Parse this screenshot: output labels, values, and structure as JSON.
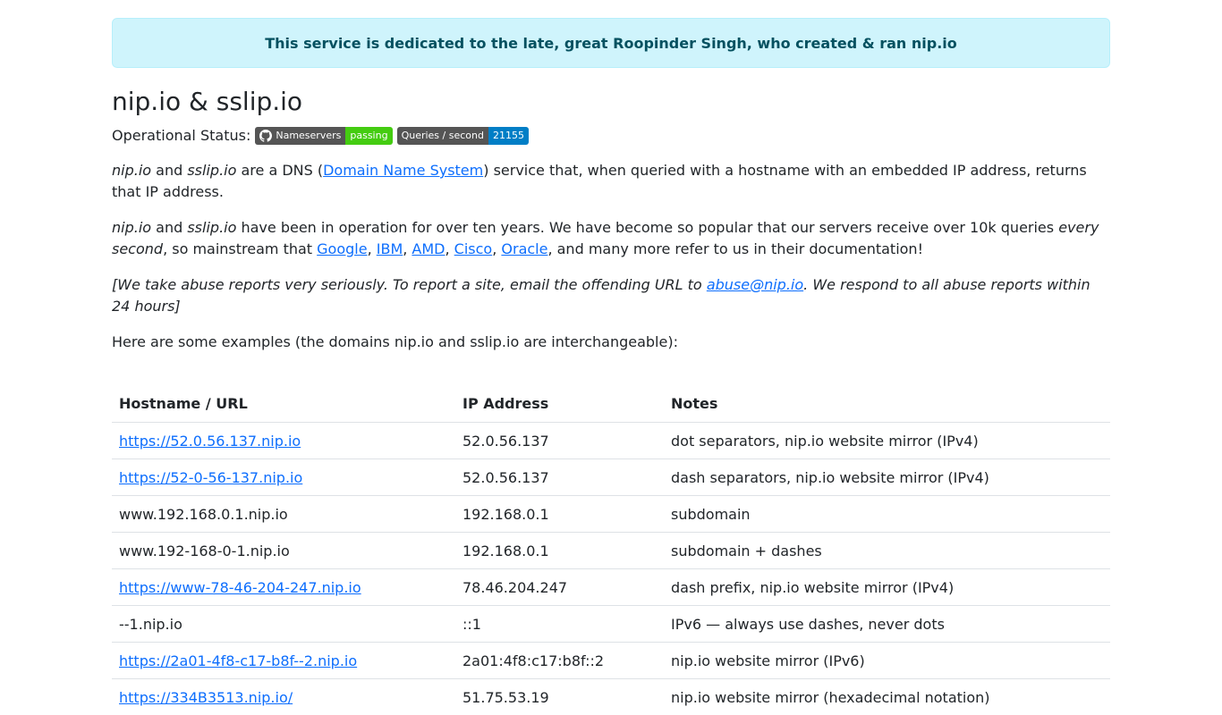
{
  "banner": "This service is dedicated to the late, great Roopinder Singh, who created & ran nip.io",
  "title": "nip.io & sslip.io",
  "status": {
    "label": "Operational Status:",
    "badge1": {
      "left": "Nameservers",
      "right": "passing",
      "right_color": "#4c1"
    },
    "badge2": {
      "left": "Queries / second",
      "right": "21155",
      "right_color": "#007ec6"
    }
  },
  "intro": {
    "nip": "nip.io",
    "and": " and ",
    "sslip": "sslip.io",
    "text1": " are a DNS (",
    "link": "Domain Name System",
    "text2": ") service that, when queried with a hostname with an embedded IP address, returns that IP address."
  },
  "popularity": {
    "nip": "nip.io",
    "and": " and ",
    "sslip": "sslip.io",
    "text1": " have been in operation for over ten years. We have become so popular that our servers receive over 10k queries ",
    "em": "every second",
    "text2": ", so mainstream that ",
    "links": [
      "Google",
      "IBM",
      "AMD",
      "Cisco",
      "Oracle"
    ],
    "sep": ", ",
    "text3": ", and many more refer to us in their documentation!"
  },
  "abuse": {
    "text1": "[We take abuse reports very seriously. To report a site, email the offending URL to ",
    "email": "abuse@nip.io",
    "text2": ". We respond to all abuse reports within 24 hours]"
  },
  "examples_intro": "Here are some examples (the domains nip.io and sslip.io are interchangeable):",
  "table": {
    "headers": [
      "Hostname / URL",
      "IP Address",
      "Notes"
    ],
    "rows": [
      {
        "host": "https://52.0.56.137.nip.io",
        "link": true,
        "ip": "52.0.56.137",
        "notes": "dot separators, nip.io website mirror (IPv4)"
      },
      {
        "host": "https://52-0-56-137.nip.io",
        "link": true,
        "ip": "52.0.56.137",
        "notes": "dash separators, nip.io website mirror (IPv4)"
      },
      {
        "host": "www.192.168.0.1.nip.io",
        "link": false,
        "ip": "192.168.0.1",
        "notes": "subdomain"
      },
      {
        "host": "www.192-168-0-1.nip.io",
        "link": false,
        "ip": "192.168.0.1",
        "notes": "subdomain + dashes"
      },
      {
        "host": "https://www-78-46-204-247.nip.io",
        "link": true,
        "ip": "78.46.204.247",
        "notes": "dash prefix, nip.io website mirror (IPv4)"
      },
      {
        "host": "--1.nip.io",
        "link": false,
        "ip": "::1",
        "notes": "IPv6 — always use dashes, never dots"
      },
      {
        "host": "https://2a01-4f8-c17-b8f--2.nip.io",
        "link": true,
        "ip": "2a01:4f8:c17:b8f::2",
        "notes": "nip.io website mirror (IPv6)"
      },
      {
        "host": "https://334B3513.nip.io/",
        "link": true,
        "ip": "51.75.53.19",
        "notes": "nip.io website mirror (hexadecimal notation)"
      }
    ]
  }
}
